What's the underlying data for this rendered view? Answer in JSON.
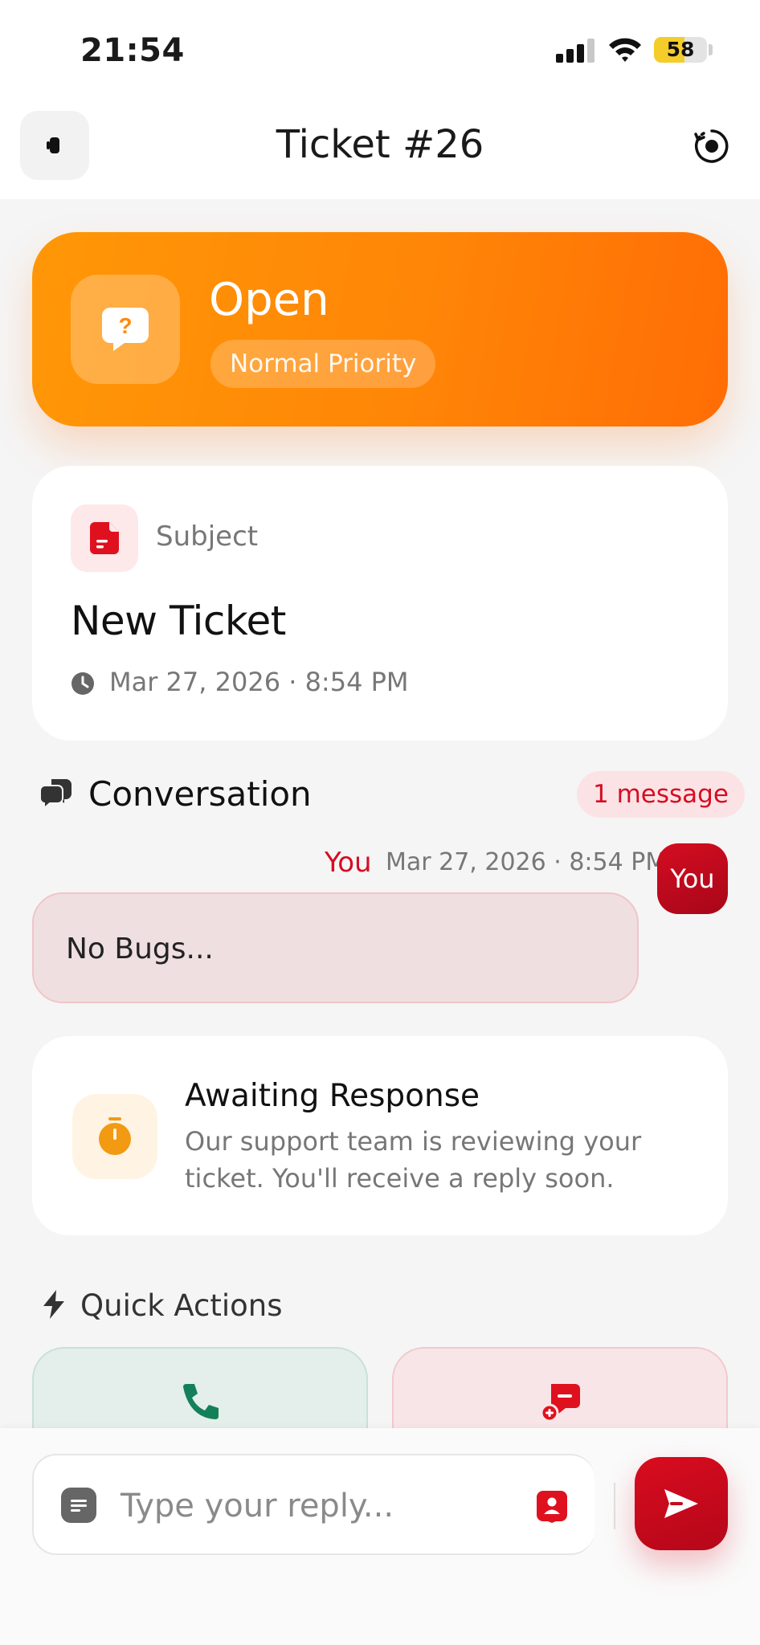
{
  "status_bar": {
    "time": "21:54",
    "battery": "58"
  },
  "header": {
    "title": "Ticket #26",
    "back_icon": "back-icon",
    "refresh_icon": "refresh-icon"
  },
  "status_card": {
    "status": "Open",
    "priority": "Normal Priority",
    "icon": "help-chat-icon"
  },
  "subject_card": {
    "label": "Subject",
    "title": "New Ticket",
    "date": "Mar 27, 2026 · 8:54 PM"
  },
  "conversation": {
    "title": "Conversation",
    "count": "1 message",
    "messages": [
      {
        "sender": "You",
        "time": "Mar 27, 2026 · 8:54 PM",
        "avatar": "You",
        "text": "No Bugs..."
      }
    ]
  },
  "awaiting": {
    "title": "Awaiting Response",
    "description": "Our support team is reviewing your ticket. You'll receive a reply soon."
  },
  "quick_actions": {
    "title": "Quick Actions",
    "items": [
      {
        "icon": "phone-icon"
      },
      {
        "icon": "message-remove-icon"
      }
    ]
  },
  "reply": {
    "placeholder": "Type your reply..."
  },
  "colors": {
    "accent": "#d60c22",
    "status_orange": "#ff8607",
    "background": "#f5f5f5"
  }
}
